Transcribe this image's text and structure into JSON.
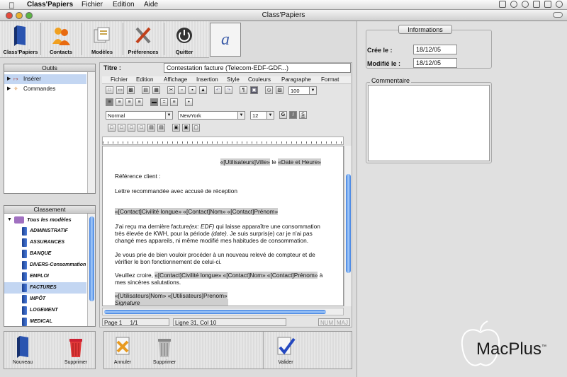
{
  "menubar": {
    "app": "Class'Papiers",
    "items": [
      "Fichier",
      "Edition",
      "Aide"
    ]
  },
  "window": {
    "title": "Class'Papiers"
  },
  "toolbar": {
    "items": [
      "Class'Papiers",
      "Contacts",
      "Modèles",
      "Préferences",
      "Quitter"
    ],
    "logo_glyph": "a"
  },
  "outils": {
    "header": "Outils",
    "items": [
      "Insérer",
      "Commandes"
    ]
  },
  "classement": {
    "header": "Classement",
    "root": "Tous les modèles",
    "items": [
      "ADMINISTRATIF",
      "ASSURANCES",
      "BANQUE",
      "DIVERS-Consommation",
      "EMPLOI",
      "FACTURES",
      "IMPÔT",
      "LOGEMENT",
      "MEDICAL"
    ],
    "selected": "FACTURES"
  },
  "left_buttons": {
    "new": "Nouveau",
    "delete": "Supprimer"
  },
  "editor": {
    "title_label": "Titre :",
    "title_value": "Contestation facture (Telecom-EDF-GDF...)",
    "menu": [
      "Fichier",
      "Edition",
      "Affichage",
      "Insertion",
      "Style",
      "Couleurs",
      "Paragraphe",
      "Format"
    ],
    "zoom": "100",
    "style": "Normal",
    "font": "NewYork",
    "size": "12",
    "bold": "G",
    "italic": "I",
    "underline": "S",
    "doc": {
      "line1_a": "«[Utilisateurs]Ville»",
      "line1_b": " le ",
      "line1_c": "«Date et Heure»",
      "ref": "Référence client :",
      "lettre": "Lettre recommandée avec accusé de réception",
      "contact": "«[Contact]Civilité longue» «[Contact]Nom» «[Contact]Prénom»",
      "body1_a": "J'ai reçu ma dernière facture",
      "body1_b": "(ex: EDF)",
      "body1_c": " qui laisse apparaître une consommation très élevée de KWH, pour la période ",
      "body1_d": "(date).",
      "body1_e": " Je suis surpris(e) car je n'ai pas changé mes appareils, ni même modifié mes habitudes de consommation.",
      "body2": "Je vous prie de bien vouloir procéder à un nouveau relevé de compteur et de vérifier le bon fonctionnement de celui-ci.",
      "closing_a": "Veuillez croire, ",
      "closing_b": "«[Contact]Civilité longue» «[Contact]Nom» «[Contact]Prénom»",
      "closing_c": " à mes sincères salutations.",
      "sign_name": "«[Utilisateurs]Nom» «[Utilisateurs]Prenom»",
      "signature": "Signature"
    },
    "status": {
      "page": "Page 1",
      "pages": "1/1",
      "pos": "Ligne 31, Col 10",
      "num": "NUM",
      "maj": "MAJ"
    }
  },
  "editor_buttons": {
    "cancel": "Annuler",
    "delete": "Supprimer",
    "validate": "Valider"
  },
  "info": {
    "header": "Informations",
    "created_label": "Crée le :",
    "created": "18/12/05",
    "modified_label": "Modifié le :",
    "modified": "18/12/05",
    "comment_label": "Commentaire"
  },
  "watermark": {
    "brand": "MacPlus",
    "tm": "™"
  }
}
